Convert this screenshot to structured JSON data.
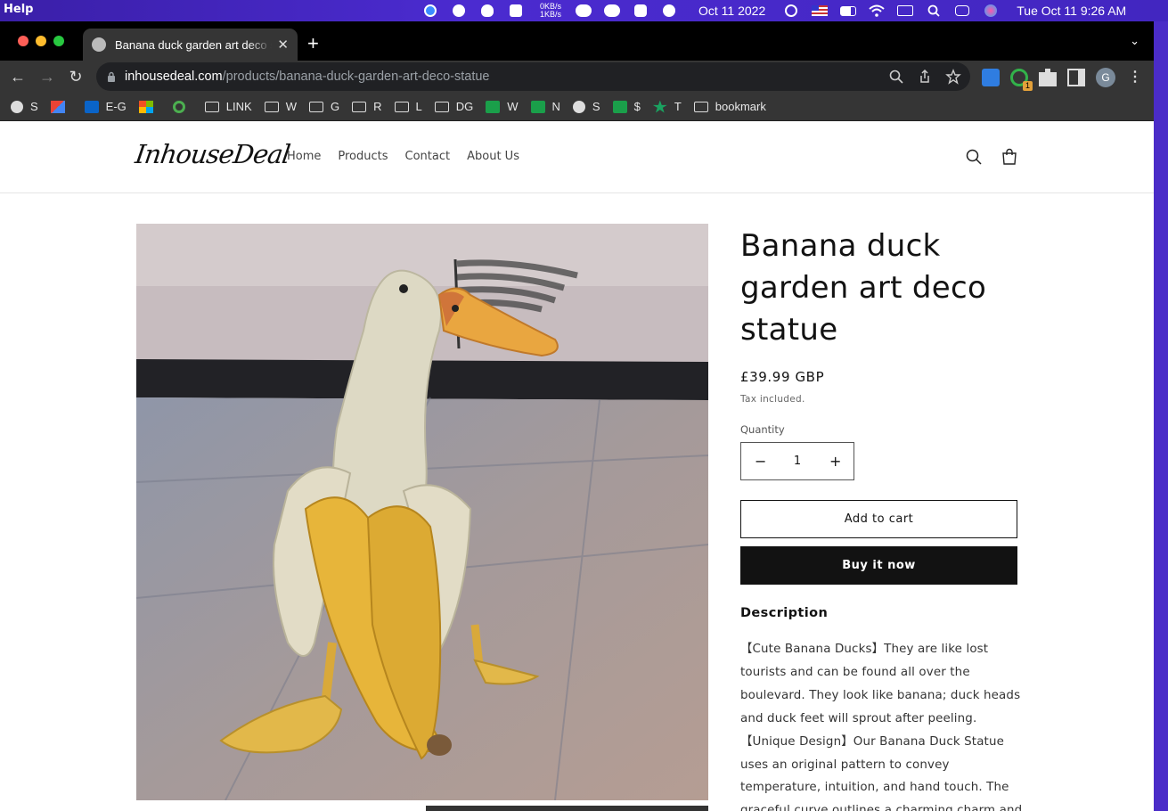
{
  "menubar": {
    "app_menu": "Help",
    "net_up": "0KB/s",
    "net_down": "1KB/s",
    "date": "Oct 11 2022",
    "clock": "Tue Oct 11  9:26 AM"
  },
  "browser": {
    "tab_title": "Banana duck garden art deco statue",
    "url_host": "inhousedeal.com",
    "url_path": "/products/banana-duck-garden-art-deco-statue",
    "profile_initial": "G",
    "extension_badge": "1",
    "bookmarks": [
      {
        "label": "S",
        "icon": "globe"
      },
      {
        "label": "",
        "icon": "gmail"
      },
      {
        "label": "E-G",
        "icon": "outlook"
      },
      {
        "label": "",
        "icon": "microsoft"
      },
      {
        "label": "",
        "icon": "g-green"
      },
      {
        "label": "LINK",
        "icon": "folder"
      },
      {
        "label": "W",
        "icon": "folder"
      },
      {
        "label": "G",
        "icon": "folder"
      },
      {
        "label": "R",
        "icon": "folder"
      },
      {
        "label": "L",
        "icon": "folder"
      },
      {
        "label": "DG",
        "icon": "folder"
      },
      {
        "label": "W",
        "icon": "sheets"
      },
      {
        "label": "N",
        "icon": "sheets"
      },
      {
        "label": "S",
        "icon": "globe"
      },
      {
        "label": "$",
        "icon": "sheets"
      },
      {
        "label": "T",
        "icon": "star"
      },
      {
        "label": "bookmark",
        "icon": "folder"
      }
    ]
  },
  "site": {
    "logo": "InhouseDeal",
    "nav": [
      "Home",
      "Products",
      "Contact",
      "About Us"
    ]
  },
  "product": {
    "title": "Banana duck garden art deco statue",
    "price": "£39.99 GBP",
    "tax_note": "Tax included.",
    "quantity_label": "Quantity",
    "quantity": "1",
    "add_to_cart": "Add to cart",
    "buy_now": "Buy it now",
    "description_heading": "Description",
    "description": "【Cute Banana Ducks】They are like lost tourists and can be found all over the boulevard. They look like banana; duck heads and duck feet will sprout after peeling. 【Unique Design】Our Banana Duck Statue uses an original pattern to convey temperature, intuition, and hand touch. The graceful curve outlines a charming charm and presents"
  },
  "colors": {
    "accent_dark": "#121212",
    "menubar": "#4b2bd0",
    "banana_yellow": "#e7b53a"
  }
}
